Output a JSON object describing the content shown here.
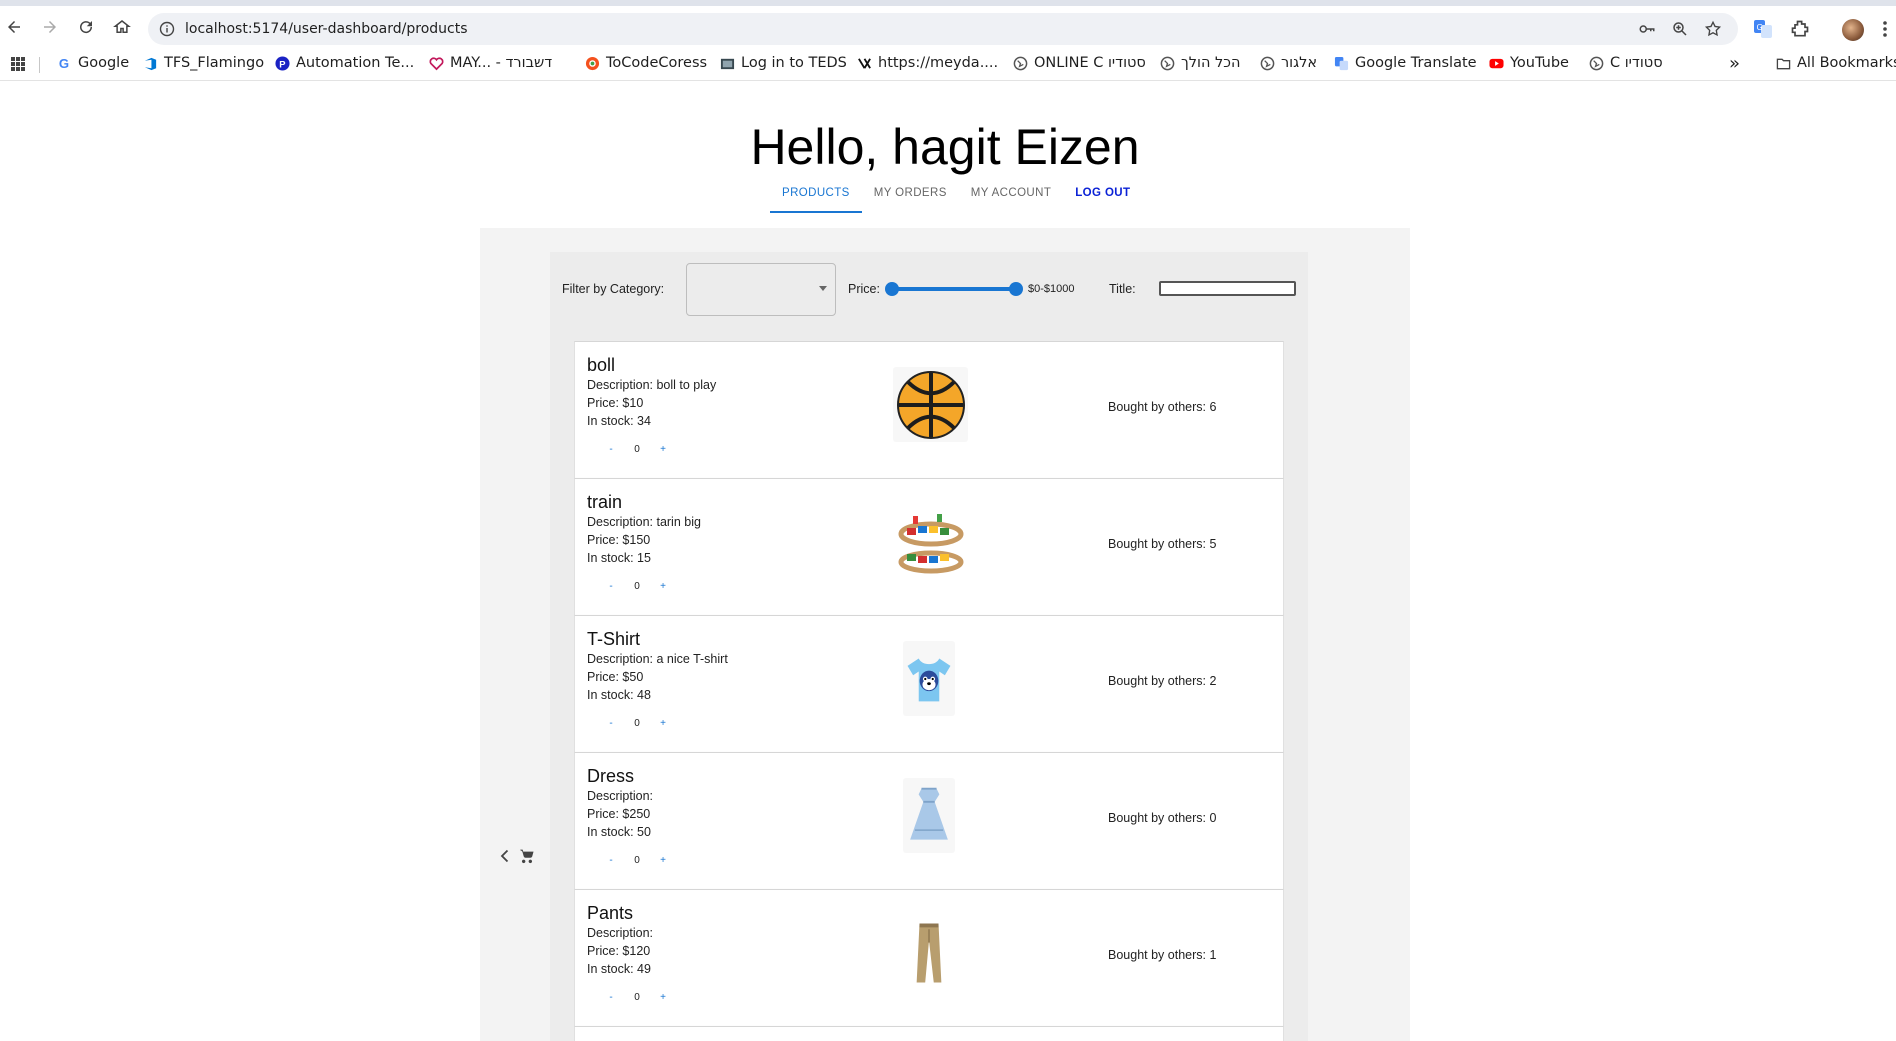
{
  "browser": {
    "url": "localhost:5174/user-dashboard/products",
    "bookmarks": [
      {
        "label": "Google",
        "icon": "google-icon"
      },
      {
        "label": "TFS_Flamingo",
        "icon": "azure-devops-icon"
      },
      {
        "label": "Automation Te...",
        "icon": "p-logo-icon"
      },
      {
        "label": "MAY... - דשבורד",
        "icon": "heart-icon"
      },
      {
        "label": "ToCodeCoress",
        "icon": "tocode-icon"
      },
      {
        "label": "Log in to TEDS",
        "icon": "teds-icon"
      },
      {
        "label": "https://meyda....",
        "icon": "meyda-icon"
      },
      {
        "label": "ONLINE C סטודיו",
        "icon": "globe-icon"
      },
      {
        "label": "הכל הולך",
        "icon": "globe-icon"
      },
      {
        "label": "אלגור",
        "icon": "globe-icon"
      },
      {
        "label": "Google Translate",
        "icon": "translate-icon"
      },
      {
        "label": "YouTube",
        "icon": "youtube-icon"
      },
      {
        "label": "C סטודיו",
        "icon": "globe-icon"
      }
    ],
    "all_bookmarks": "All Bookmarks",
    "overflow": "»"
  },
  "header": {
    "greeting": "Hello, hagit Eizen"
  },
  "tabs": [
    {
      "label": "PRODUCTS",
      "active": true
    },
    {
      "label": "MY ORDERS",
      "active": false
    },
    {
      "label": "MY ACCOUNT",
      "active": false
    },
    {
      "label": "LOG OUT",
      "active": false
    }
  ],
  "filters": {
    "category_label": "Filter by Category:",
    "category_value": "",
    "price_label": "Price:",
    "price_range_text": "$0-$1000",
    "price_min": 0,
    "price_max": 1000,
    "title_label": "Title:",
    "title_value": ""
  },
  "products": [
    {
      "name": "boll",
      "description": "Description: boll to play",
      "price": "Price: $10",
      "stock": "In stock: 34",
      "qty": "0",
      "bought": "Bought by others: 6",
      "image_icon": "ball-icon"
    },
    {
      "name": "train",
      "description": "Description: tarin big",
      "price": "Price: $150",
      "stock": "In stock: 15",
      "qty": "0",
      "bought": "Bought by others: 5",
      "image_icon": "train-icon"
    },
    {
      "name": "T-Shirt",
      "description": "Description: a nice T-shirt",
      "price": "Price: $50",
      "stock": "In stock: 48",
      "qty": "0",
      "bought": "Bought by others: 2",
      "image_icon": "tshirt-icon"
    },
    {
      "name": "Dress",
      "description": "Description:",
      "price": "Price: $250",
      "stock": "In stock: 50",
      "qty": "0",
      "bought": "Bought by others: 0",
      "image_icon": "dress-icon"
    },
    {
      "name": "Pants",
      "description": "Description:",
      "price": "Price: $120",
      "stock": "In stock: 49",
      "qty": "0",
      "bought": "Bought by others: 1",
      "image_icon": "pants-icon"
    }
  ],
  "qty_controls": {
    "minus": "-",
    "plus": "+"
  },
  "colors": {
    "accent": "#1976d2",
    "logout": "#0b22d6",
    "panel": "#f3f3f3"
  }
}
